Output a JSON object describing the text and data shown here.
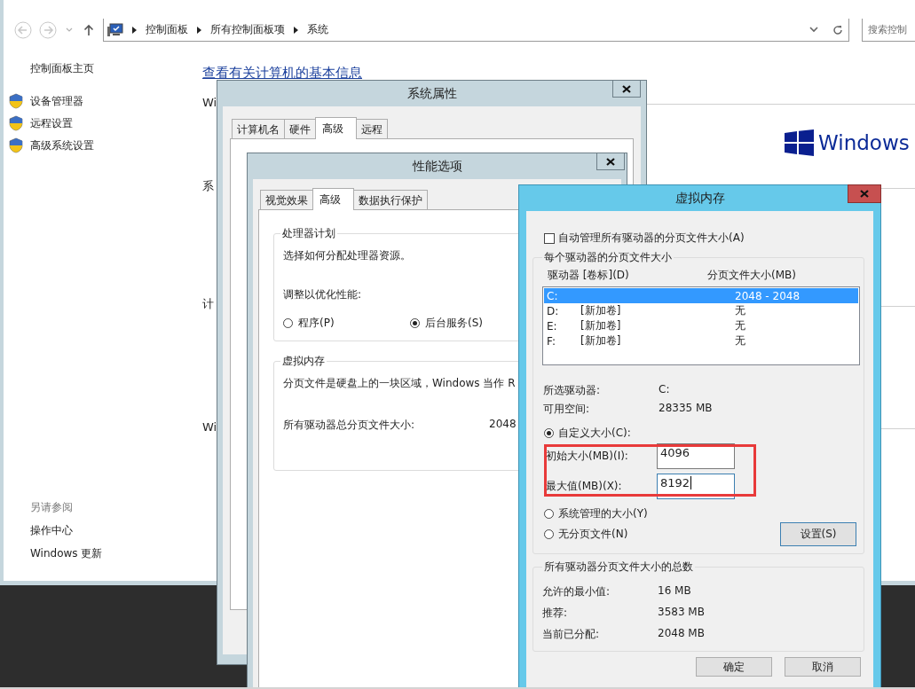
{
  "explorer": {
    "breadcrumb": [
      "控制面板",
      "所有控制面板项",
      "系统"
    ],
    "search": {
      "placeholder": "搜索控制"
    },
    "sidebar": {
      "home": "控制面板主页",
      "links": [
        "设备管理器",
        "远程设置",
        "高级系统设置"
      ],
      "see_also": "另请参阅",
      "see_also_links": [
        "操作中心",
        "Windows 更新"
      ]
    },
    "heading": "查看有关计算机的基本信息",
    "fragments": [
      "Wi",
      "系",
      "计",
      "Wi"
    ],
    "brand": "Windows"
  },
  "system_properties": {
    "title": "系统属性",
    "tabs": [
      {
        "label": "计算机名",
        "selected": false
      },
      {
        "label": "硬件",
        "selected": false
      },
      {
        "label": "高级",
        "selected": true
      },
      {
        "label": "远程",
        "selected": false
      }
    ]
  },
  "performance_options": {
    "title": "性能选项",
    "tabs": [
      {
        "label": "视觉效果",
        "selected": false
      },
      {
        "label": "高级",
        "selected": true
      },
      {
        "label": "数据执行保护",
        "selected": false
      }
    ],
    "processor_group": {
      "title": "处理器计划",
      "description": "选择如何分配处理器资源。",
      "prompt": "调整以优化性能:",
      "options": [
        {
          "label": "程序(P)",
          "selected": false
        },
        {
          "label": "后台服务(S)",
          "selected": true
        }
      ]
    },
    "vm_group": {
      "title": "虚拟内存",
      "description": "分页文件是硬盘上的一块区域，Windows 当作 R",
      "total_label": "所有驱动器总分页文件大小:",
      "total_value": "2048"
    }
  },
  "virtual_memory": {
    "title": "虚拟内存",
    "auto_manage": {
      "label": "自动管理所有驱动器的分页文件大小(A)",
      "checked": false
    },
    "group_title": "每个驱动器的分页文件大小",
    "columns": [
      "驱动器 [卷标](D)",
      "分页文件大小(MB)"
    ],
    "drives": [
      {
        "drive": "C:",
        "size": "2048 - 2048",
        "selected": true
      },
      {
        "drive": "D:",
        "label": "[新加卷]",
        "size": "无",
        "selected": false
      },
      {
        "drive": "E:",
        "label": "[新加卷]",
        "size": "无",
        "selected": false
      },
      {
        "drive": "F:",
        "label": "[新加卷]",
        "size": "无",
        "selected": false
      }
    ],
    "info": [
      {
        "label": "所选驱动器:",
        "value": "C:"
      },
      {
        "label": "可用空间:",
        "value": "28335 MB"
      }
    ],
    "size_options": [
      {
        "kind": "custom",
        "label": "自定义大小(C):",
        "selected": true,
        "fields": [
          {
            "label": "初始大小(MB)(I):",
            "value": "4096",
            "focused": false
          },
          {
            "label": "最大值(MB)(X):",
            "value": "8192",
            "focused": true
          }
        ]
      },
      {
        "kind": "plain",
        "label": "系统管理的大小(Y)",
        "selected": false
      },
      {
        "kind": "button",
        "label": "无分页文件(N)",
        "selected": false,
        "button": "设置(S)"
      }
    ],
    "highlight_fields": true,
    "totals": {
      "title": "所有驱动器分页文件大小的总数",
      "rows": [
        {
          "label": "允许的最小值:",
          "value": "16 MB"
        },
        {
          "label": "推荐:",
          "value": "3583 MB"
        },
        {
          "label": "当前已分配:",
          "value": "2048 MB"
        }
      ]
    },
    "buttons": [
      "确定",
      "取消"
    ]
  }
}
